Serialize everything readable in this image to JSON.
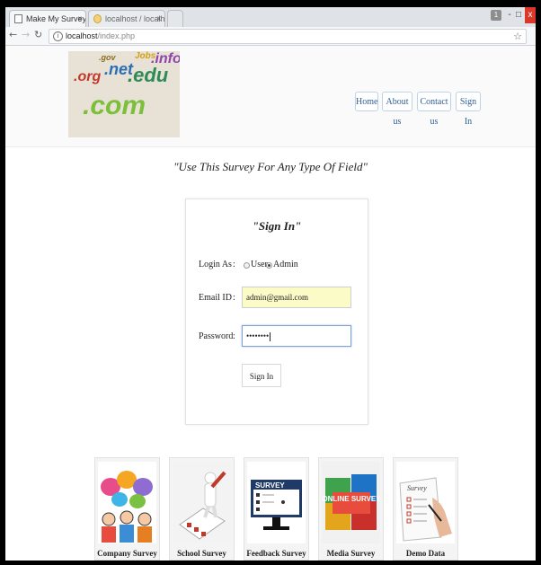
{
  "browser": {
    "tabs": [
      {
        "title": "Make My Survey",
        "close": "x"
      },
      {
        "title": "localhost / localhost / m",
        "close": "x"
      }
    ],
    "url_host": "localhost",
    "url_path": "/index.php",
    "window_controls": {
      "user": "1",
      "minimize": "-",
      "maximize": "□",
      "close": "x"
    },
    "icons": [
      "back-icon",
      "forward-icon",
      "reload-icon",
      "info-icon",
      "star-icon"
    ]
  },
  "header": {
    "logo_words": [
      ".org",
      ".gov",
      ".net",
      "Jobs",
      ".edu",
      ".info",
      ".com"
    ],
    "nav": [
      "Home",
      "About us",
      "Contact us",
      "Sign In"
    ]
  },
  "tagline": "\"Use This Survey For Any Type Of Field\"",
  "signin": {
    "title": "\"Sign In\"",
    "login_as_label": "Login As",
    "colon": ":",
    "option_user": "User",
    "option_admin": "Admin",
    "selected": "Admin",
    "email_label": "Email ID",
    "email_value": "admin@gmail.com",
    "password_label": "Password",
    "password_value": "••••••••",
    "button": "Sign In"
  },
  "cards": [
    {
      "caption": "Company Survey",
      "icon": "people-speech-bubbles-icon"
    },
    {
      "caption": "School Survey",
      "icon": "checklist-pencil-icon"
    },
    {
      "caption": "Feedback Survey",
      "icon": "monitor-survey-icon",
      "image_text": "SURVEY"
    },
    {
      "caption": "Media Survey",
      "icon": "puzzle-icon",
      "image_text": "ONLINE SURVEY"
    },
    {
      "caption": "Demo Data",
      "icon": "survey-form-icon",
      "image_text": "Survey"
    }
  ]
}
